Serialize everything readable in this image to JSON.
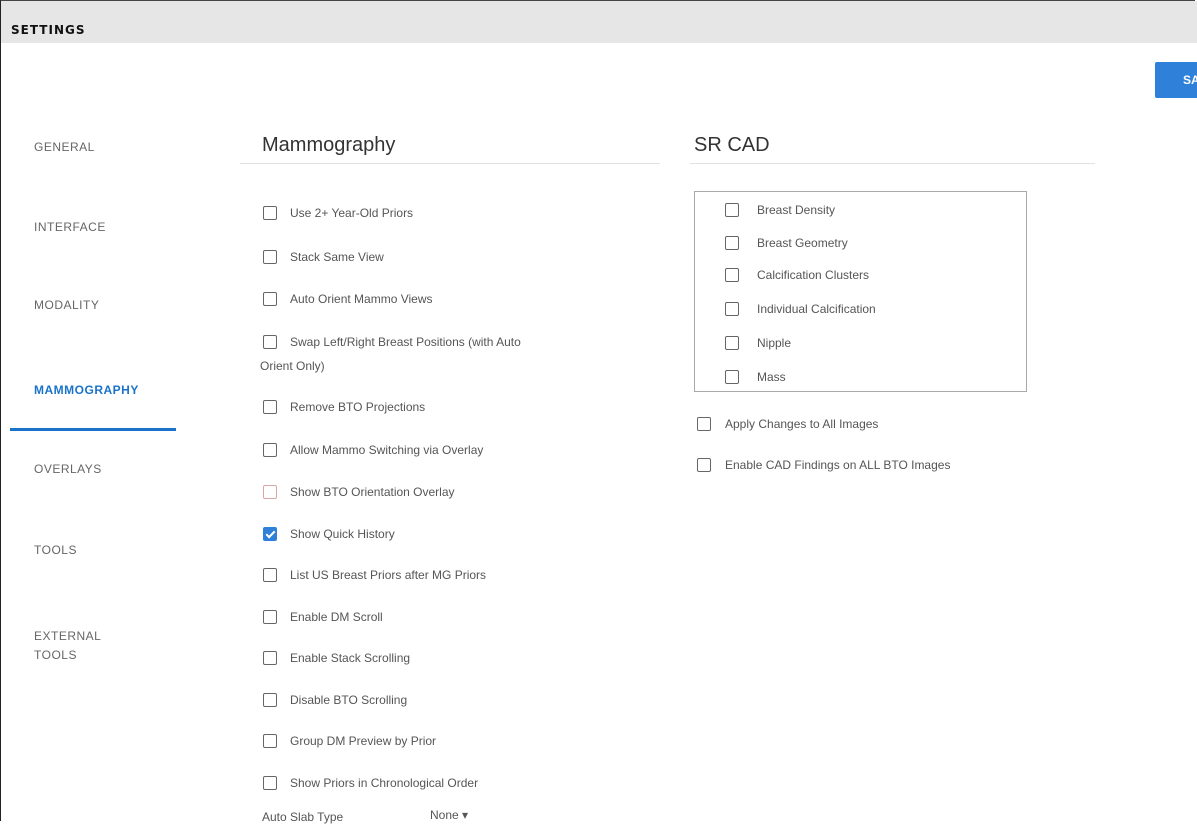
{
  "header": {
    "title": "SETTINGS"
  },
  "save_button": {
    "label": "SA"
  },
  "nav": {
    "items": [
      {
        "label": "GENERAL"
      },
      {
        "label": "INTERFACE"
      },
      {
        "label": "MODALITY"
      },
      {
        "label": "MAMMOGRAPHY",
        "active": true
      },
      {
        "label": "OVERLAYS"
      },
      {
        "label": "TOOLS"
      },
      {
        "label": "EXTERNAL\nTOOLS"
      }
    ]
  },
  "mammography": {
    "title": "Mammography",
    "options": [
      {
        "label": "Use 2+ Year-Old Priors",
        "checked": false
      },
      {
        "label": "Stack Same View",
        "checked": false
      },
      {
        "label": "Auto Orient Mammo Views",
        "checked": false
      },
      {
        "label": "Swap Left/Right Breast Positions (with Auto",
        "label_cont": "Orient Only)",
        "checked": false
      },
      {
        "label": "Remove BTO Projections",
        "checked": false
      },
      {
        "label": "Allow Mammo Switching via Overlay",
        "checked": false
      },
      {
        "label": "Show BTO Orientation Overlay",
        "checked": false
      },
      {
        "label": "Show Quick History",
        "checked": true
      },
      {
        "label": "List US Breast Priors after MG Priors",
        "checked": false
      },
      {
        "label": "Enable DM Scroll",
        "checked": false
      },
      {
        "label": "Enable Stack Scrolling",
        "checked": false
      },
      {
        "label": "Disable BTO Scrolling",
        "checked": false
      },
      {
        "label": "Group DM Preview by Prior",
        "checked": false
      },
      {
        "label": "Show Priors in Chronological Order",
        "checked": false
      }
    ],
    "auto_slab": {
      "label": "Auto Slab Type",
      "value": "None"
    }
  },
  "sr_cad": {
    "title": "SR CAD",
    "findings": [
      {
        "label": "Breast Density",
        "checked": false
      },
      {
        "label": "Breast Geometry",
        "checked": false
      },
      {
        "label": "Calcification Clusters",
        "checked": false
      },
      {
        "label": "Individual Calcification",
        "checked": false
      },
      {
        "label": "Nipple",
        "checked": false
      },
      {
        "label": "Mass",
        "checked": false
      }
    ],
    "options": [
      {
        "label": "Apply Changes to All Images",
        "checked": false
      },
      {
        "label": "Enable CAD Findings on ALL BTO Images",
        "checked": false
      }
    ]
  },
  "colors": {
    "accent": "#1a73c9",
    "button": "#2f80d8",
    "header_bg": "#e6e6e6"
  }
}
